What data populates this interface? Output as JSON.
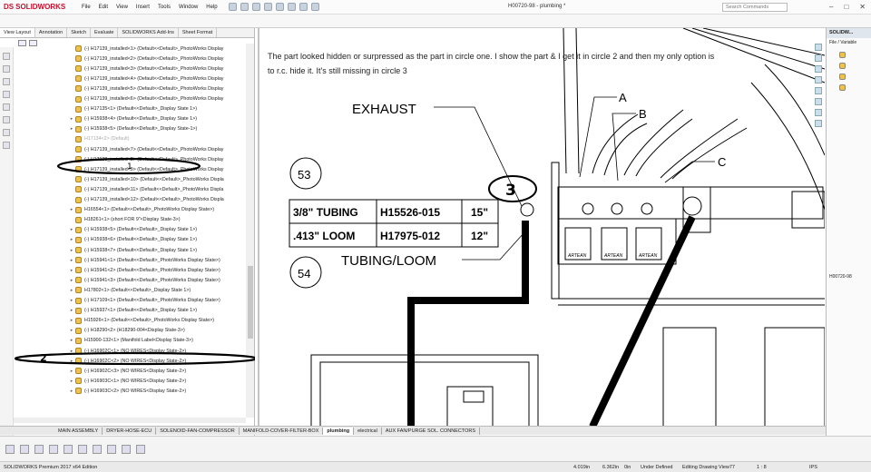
{
  "app": {
    "name": "SOLIDWORKS",
    "title": "H00720-98 - plumbing *"
  },
  "menu": [
    "File",
    "Edit",
    "View",
    "Insert",
    "Tools",
    "Window",
    "Help"
  ],
  "search_placeholder": "Search Commands",
  "left_panel": {
    "tabs": [
      "View Layout",
      "Annotation",
      "Sketch",
      "Evaluate",
      "SOLIDWORKS Add-Ins",
      "Sheet Format"
    ],
    "tree": [
      {
        "label": "(-) H17139_installed<1> (Default<<Default>_PhotoWorks Display",
        "expandable": false
      },
      {
        "label": "(-) H17139_installed<2> (Default<<Default>_PhotoWorks Display",
        "expandable": false
      },
      {
        "label": "(-) H17139_installed<3> (Default<<Default>_PhotoWorks Display",
        "expandable": false
      },
      {
        "label": "(-) H17139_installed<4> (Default<<Default>_PhotoWorks Display",
        "expandable": false
      },
      {
        "label": "(-) H17139_installed<5> (Default<<Default>_PhotoWorks Display",
        "expandable": false
      },
      {
        "label": "(-) H17139_installed<6> (Default<<Default>_PhotoWorks Display",
        "expandable": false
      },
      {
        "label": "(-) H17135<1> (Default<<Default>_Display State 1>)",
        "expandable": false
      },
      {
        "label": "(-) H15938<4> (Default<<Default>_Display State 1>)",
        "expandable": true
      },
      {
        "label": "(-) H15938<5> (Default<<Default>_Display State-1>)",
        "expandable": true
      },
      {
        "label": "H17134<2> (Default)",
        "expandable": false,
        "grey": true
      },
      {
        "label": "(-) H17139_installed<7> (Default<<Default>_PhotoWorks Display",
        "expandable": false
      },
      {
        "label": "(-) H17139_installed<8> (Default<<Default>_PhotoWorks Display",
        "expandable": false
      },
      {
        "label": "(-) H17139_installed<9> (Default<<Default>_PhotoWorks Display",
        "expandable": false
      },
      {
        "label": "(-) H17139_installed<10> (Default<<Default>_PhotoWorks Displa",
        "expandable": false
      },
      {
        "label": "(-) H17139_installed<11> (Default<<Default>_PhotoWorks Displa",
        "expandable": false
      },
      {
        "label": "(-) H17139_installed<12> (Default<<Default>_PhotoWorks Displa",
        "expandable": false
      },
      {
        "label": "H16554<1> (Default<<Default>_PhotoWorks Display State>)",
        "expandable": true
      },
      {
        "label": "H18261<1> (short FOR 9\"<Display State-3>)",
        "expandable": false
      },
      {
        "label": "(-) H15938<5> (Default<<Default>_Display State 1>)",
        "expandable": true
      },
      {
        "label": "(-) H15938<6> (Default<<Default>_Display State 1>)",
        "expandable": true
      },
      {
        "label": "(-) H15938<7> (Default<<Default>_Display State 1>)",
        "expandable": true
      },
      {
        "label": "(-) H15941<1> (Default<<Default>_PhotoWorks Display State>)",
        "expandable": true
      },
      {
        "label": "(-) H15941<2> (Default<<Default>_PhotoWorks Display State>)",
        "expandable": true
      },
      {
        "label": "(-) H15941<3> (Default<<Default>_PhotoWorks Display State>)",
        "expandable": true
      },
      {
        "label": "H17802<1> (Default<<Default>_Display State 1>)",
        "expandable": true
      },
      {
        "label": "(-) H17109<1> (Default<<Default>_PhotoWorks Display State>)",
        "expandable": true
      },
      {
        "label": "(-) H15937<1> (Default<<Default>_Display State 1>)",
        "expandable": true
      },
      {
        "label": "H15926<1> (Default<<Default>_PhotoWorks Display State>)",
        "expandable": true
      },
      {
        "label": "(-) H18290<2> (H18290-004<Display State-3>)",
        "expandable": true
      },
      {
        "label": "H15900-132<1> (Manifold Label<Display State-3>)",
        "expandable": true
      },
      {
        "label": "(-) H16902C<1> (NO WIRES<Display State-2>)",
        "expandable": true
      },
      {
        "label": "(-) H16902C<2> (NO WIRES<Display State-2>)",
        "expandable": true
      },
      {
        "label": "(-) H16902C<3> (NO WIRES<Display State-2>)",
        "expandable": true
      },
      {
        "label": "(-) H16903C<1> (NO WIRES<Display State-2>)",
        "expandable": true
      },
      {
        "label": "(-) H16903C<2> (NO WIRES<Display State-2>)",
        "expandable": true
      }
    ]
  },
  "canvas": {
    "note": "The part looked hidden or surpressed as the part in circle one. I show the part & I get it in circle 2 and then my only option is to r.c. hide it. It's still missing in circle 3",
    "labels": {
      "exhaust": "EXHAUST",
      "tubing_loom": "TUBING/LOOM",
      "a": "A",
      "b": "B",
      "c": "C",
      "balloon_53": "53",
      "balloon_54": "54",
      "circle_1": "1",
      "circle_2": "2",
      "circle_3": "3"
    },
    "table": [
      [
        "3/8\" TUBING",
        "H15526-015",
        "15\""
      ],
      [
        ".413\" LOOM",
        "H17975-012",
        "12\""
      ]
    ],
    "solenoid_brand": "ARTEAN"
  },
  "right_panel": {
    "title": "SOLIDW...",
    "sub": "File / Variable",
    "part": "H00720-98"
  },
  "sheets": [
    "MAIN ASSEMBLY",
    "DRYER-HOSE-ECU",
    "SOLENOID-FAN-COMPRESSOR",
    "MANIFOLD-COVER-FILTER-BOX",
    "plumbing",
    "electrical",
    "AUX FAN/PURGE SOL. CONNECTORS"
  ],
  "active_sheet": "plumbing",
  "status": {
    "edition": "SOLIDWORKS Premium 2017 x64 Edition",
    "x": "4.019in",
    "y": "6.362in",
    "z": "0in",
    "state": "Under Defined",
    "editing": "Editing Drawing View77",
    "scale": "1 : 8",
    "units": "IPS"
  },
  "colors": {
    "brand": "#c8102e",
    "accent": "#dfe6ee"
  }
}
